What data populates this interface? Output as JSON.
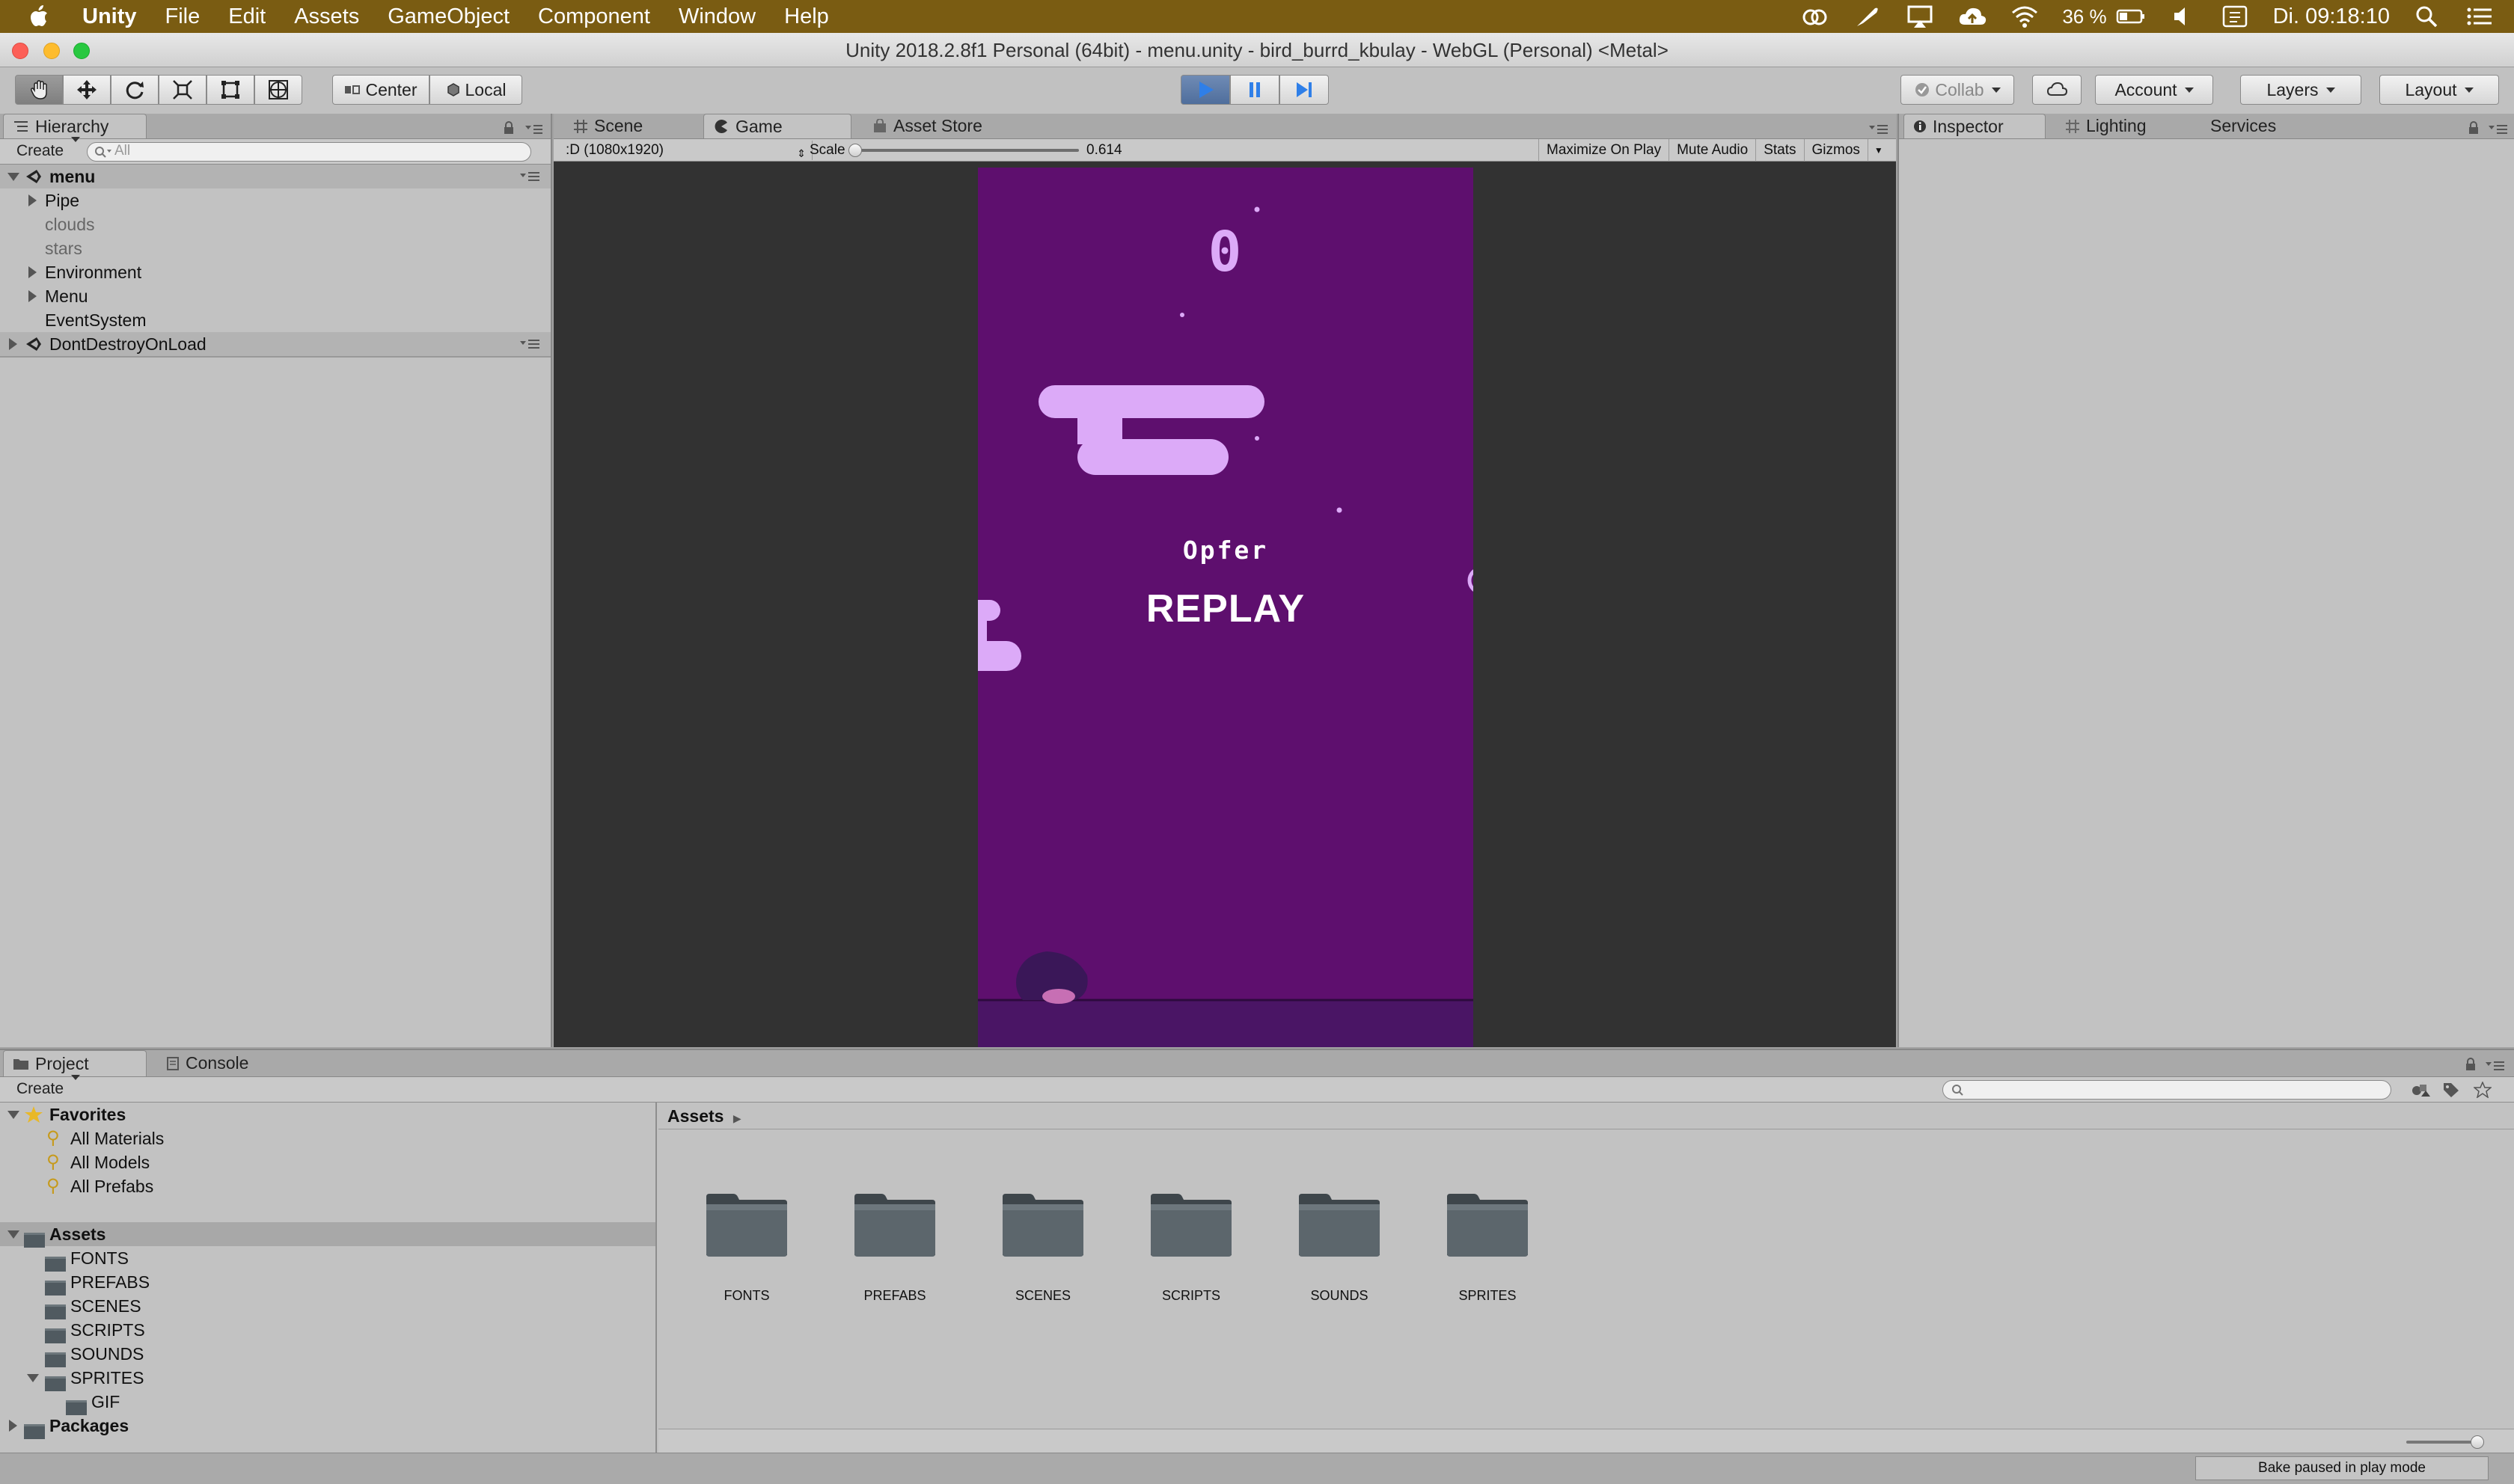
{
  "menubar": {
    "app": "Unity",
    "items": [
      "File",
      "Edit",
      "Assets",
      "GameObject",
      "Component",
      "Window",
      "Help"
    ],
    "battery": "36 %",
    "clock": "Di. 09:18:10"
  },
  "window": {
    "title": "Unity 2018.2.8f1 Personal (64bit) - menu.unity - bird_burrd_kbulay - WebGL (Personal) <Metal>"
  },
  "toolbar": {
    "pivot": "Center",
    "space": "Local",
    "collab": "Collab",
    "account": "Account",
    "layers": "Layers",
    "layout": "Layout"
  },
  "hierarchy": {
    "tab": "Hierarchy",
    "create": "Create",
    "search_placeholder": "All",
    "scene": "menu",
    "items": [
      {
        "label": "Pipe"
      },
      {
        "label": "clouds"
      },
      {
        "label": "stars"
      },
      {
        "label": "Environment"
      },
      {
        "label": "Menu"
      },
      {
        "label": "EventSystem"
      }
    ],
    "dont_destroy": "DontDestroyOnLoad"
  },
  "center_tabs": {
    "scene": "Scene",
    "game": "Game",
    "asset_store": "Asset Store"
  },
  "game_bar": {
    "resolution": ":D (1080x1920)",
    "scale_label": "Scale",
    "scale_value": "0.614",
    "scale_fraction": 0.614,
    "maximize": "Maximize On Play",
    "mute": "Mute Audio",
    "stats": "Stats",
    "gizmos": "Gizmos"
  },
  "game": {
    "score": "0",
    "player_label": "Opfer",
    "replay": "REPLAY",
    "colors": {
      "bg": "#5e0f6e",
      "ground": "#4a1565",
      "cloud": "#dcaaf8"
    }
  },
  "right_tabs": {
    "inspector": "Inspector",
    "lighting": "Lighting",
    "services": "Services"
  },
  "project": {
    "tab": "Project",
    "console_tab": "Console",
    "create": "Create",
    "favorites": {
      "label": "Favorites",
      "items": [
        "All Materials",
        "All Models",
        "All Prefabs"
      ]
    },
    "assets_label": "Assets",
    "asset_folders": [
      "FONTS",
      "PREFABS",
      "SCENES",
      "SCRIPTS",
      "SOUNDS",
      "SPRITES"
    ],
    "sprites_child": "GIF",
    "packages": "Packages",
    "breadcrumb": "Assets"
  },
  "status": {
    "bake": "Bake paused in play mode"
  }
}
